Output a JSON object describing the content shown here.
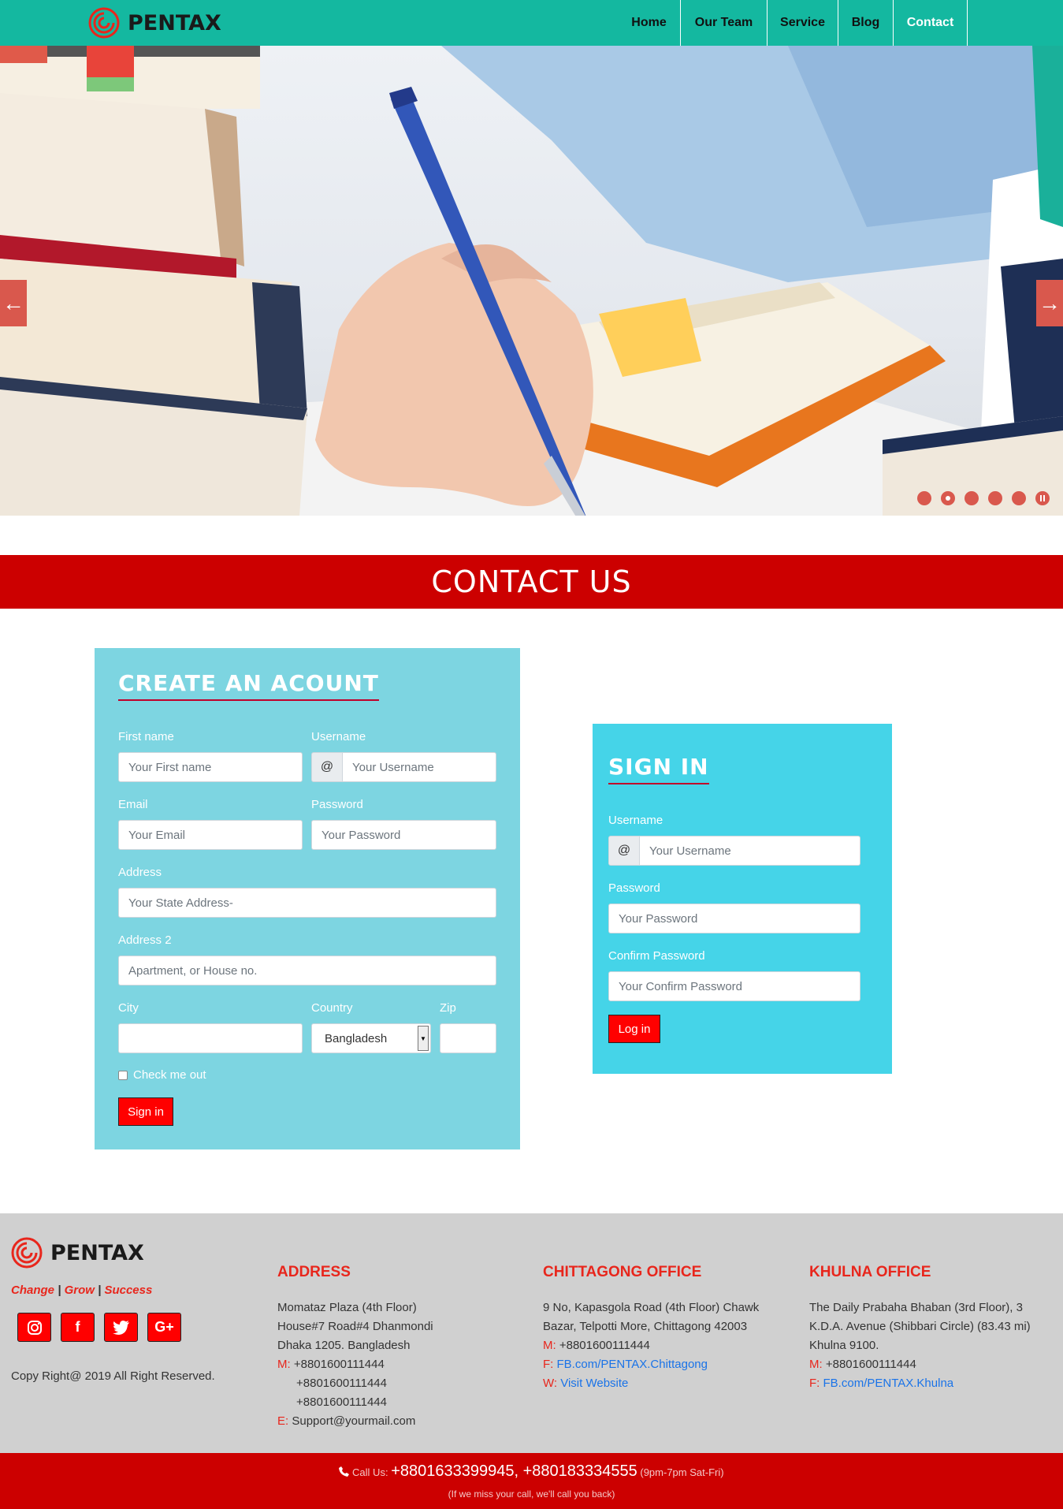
{
  "brand": {
    "name": "PENTAX",
    "logo_icon": "spiral-logo-icon",
    "logo_color": "#e8261c"
  },
  "nav": {
    "items": [
      {
        "label": "Home",
        "active": false
      },
      {
        "label": "Our Team",
        "active": false
      },
      {
        "label": "Service",
        "active": false
      },
      {
        "label": "Blog",
        "active": false
      },
      {
        "label": "Contact",
        "active": true
      }
    ],
    "bar_color": "#14b8a0"
  },
  "slider": {
    "prev_icon": "arrow-left-icon",
    "next_icon": "arrow-right-icon",
    "prev_glyph": "←",
    "next_glyph": "→",
    "dot_count": 6,
    "current_index": 2,
    "accent": "#d9584d"
  },
  "contact_banner": {
    "title": "CONTACT US",
    "color": "#cc0000"
  },
  "create_account": {
    "title": "CREATE AN ACOUNT",
    "first_name": {
      "label": "First name",
      "placeholder": "Your First name"
    },
    "username": {
      "label": "Username",
      "addon": "@",
      "placeholder": "Your Username"
    },
    "email": {
      "label": "Email",
      "placeholder": "Your Email"
    },
    "password": {
      "label": "Password",
      "placeholder": "Your Password"
    },
    "address": {
      "label": "Address",
      "placeholder": "Your State Address-"
    },
    "address2": {
      "label": "Address 2",
      "placeholder": "Apartment, or House no."
    },
    "city": {
      "label": "City",
      "value": ""
    },
    "country": {
      "label": "Country",
      "value": "Bangladesh"
    },
    "zip": {
      "label": "Zip",
      "value": ""
    },
    "check": {
      "label": "Check me out"
    },
    "submit": "Sign in",
    "panel_color": "#7dd5e1"
  },
  "sign_in": {
    "title": "SIGN IN",
    "username": {
      "label": "Username",
      "addon": "@",
      "placeholder": "Your Username"
    },
    "password": {
      "label": "Password",
      "placeholder": "Your Password"
    },
    "confirm": {
      "label": "Confirm Password",
      "placeholder": "Your Confirm Password"
    },
    "submit": "Log in",
    "panel_color": "#45d4e8"
  },
  "footer": {
    "brand": "PENTAX",
    "tagline": [
      "Change",
      "Grow",
      "Success"
    ],
    "tagline_separator": "|",
    "socials": [
      {
        "icon": "instagram-icon",
        "glyph": "◎"
      },
      {
        "icon": "facebook-icon",
        "glyph": "f"
      },
      {
        "icon": "twitter-icon",
        "glyph": "🐦"
      },
      {
        "icon": "google-plus-icon",
        "glyph": "G+"
      }
    ],
    "copyright": "Copy Right@ 2019 All Right Reserved.",
    "address": {
      "title": "ADDRESS",
      "line1": "Momataz Plaza (4th Floor)",
      "line2": "House#7 Road#4 Dhanmondi",
      "line3": "Dhaka 1205. Bangladesh",
      "m_key": "M:",
      "phones": [
        "+8801600111444",
        "+8801600111444",
        "+8801600111444"
      ],
      "e_key": "E:",
      "email": "Support@yourmail.com"
    },
    "chittagong": {
      "title": "CHITTAGONG OFFICE",
      "line1": "9 No, Kapasgola Road (4th Floor) Chawk",
      "line2": "Bazar, Telpotti More, Chittagong 42003",
      "m_key": "M:",
      "phone": "+8801600111444",
      "f_key": "F:",
      "facebook": "FB.com/PENTAX.Chittagong",
      "w_key": "W:",
      "website": "Visit Website"
    },
    "khulna": {
      "title": "KHULNA OFFICE",
      "line1": "The Daily Prabaha Bhaban (3rd Floor), 3",
      "line2": "K.D.A. Avenue (Shibbari Circle) (83.43 mi)",
      "line3": "Khulna 9100.",
      "m_key": "M:",
      "phone": "+8801600111444",
      "f_key": "F:",
      "facebook": "FB.com/PENTAX.Khulna"
    }
  },
  "call_bar": {
    "icon": "phone-icon",
    "prefix": "Call Us:",
    "phones": "+8801633399945, +880183334555",
    "hours": "(9pm-7pm Sat-Fri)",
    "note": "(If we miss your call, we'll call you back)"
  }
}
